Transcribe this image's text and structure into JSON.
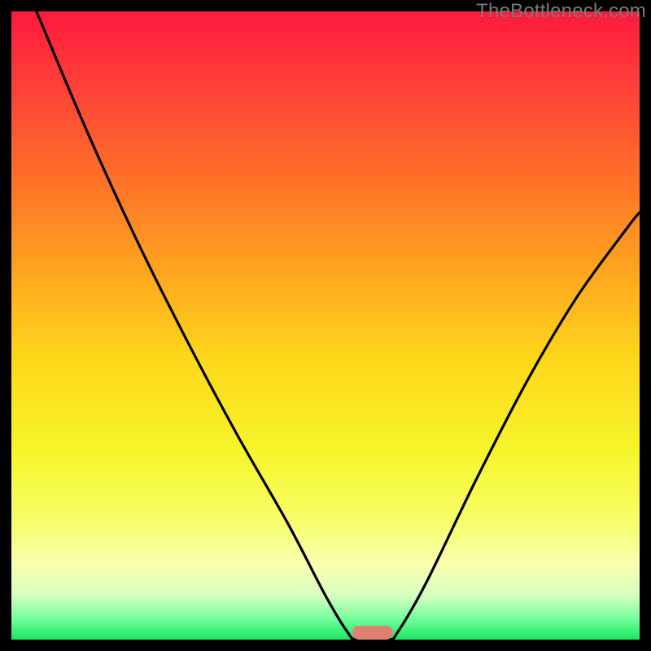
{
  "attribution": "TheBottleneck.com",
  "chart_data": {
    "type": "line",
    "title": "",
    "xlabel": "",
    "ylabel": "",
    "xlim": [
      0,
      100
    ],
    "ylim": [
      0,
      100
    ],
    "gradient_stops": [
      {
        "offset": 0.0,
        "color": "#ff1a3c"
      },
      {
        "offset": 0.1,
        "color": "#ff3a3a"
      },
      {
        "offset": 0.25,
        "color": "#ff6b2a"
      },
      {
        "offset": 0.4,
        "color": "#ffa020"
      },
      {
        "offset": 0.55,
        "color": "#ffd61a"
      },
      {
        "offset": 0.7,
        "color": "#f5f52a"
      },
      {
        "offset": 0.82,
        "color": "#f7ff70"
      },
      {
        "offset": 0.88,
        "color": "#faffb0"
      },
      {
        "offset": 0.93,
        "color": "#d6ffc0"
      },
      {
        "offset": 0.965,
        "color": "#7bff9e"
      },
      {
        "offset": 1.0,
        "color": "#18e860"
      }
    ],
    "curve_points": [
      {
        "x": 4.0,
        "y": 100.0
      },
      {
        "x": 12.0,
        "y": 81.0
      },
      {
        "x": 20.0,
        "y": 63.5
      },
      {
        "x": 28.0,
        "y": 47.5
      },
      {
        "x": 36.0,
        "y": 32.5
      },
      {
        "x": 44.0,
        "y": 18.5
      },
      {
        "x": 50.0,
        "y": 7.0
      },
      {
        "x": 53.5,
        "y": 1.2
      },
      {
        "x": 55.0,
        "y": 0.0
      },
      {
        "x": 60.0,
        "y": 0.0
      },
      {
        "x": 61.5,
        "y": 1.2
      },
      {
        "x": 66.0,
        "y": 9.0
      },
      {
        "x": 74.0,
        "y": 25.5
      },
      {
        "x": 82.0,
        "y": 41.0
      },
      {
        "x": 90.0,
        "y": 54.5
      },
      {
        "x": 98.0,
        "y": 65.5
      },
      {
        "x": 100.0,
        "y": 68.0
      }
    ],
    "marker": {
      "x_center": 57.5,
      "width": 6.5,
      "height": 2.2,
      "color": "#e08070"
    }
  }
}
